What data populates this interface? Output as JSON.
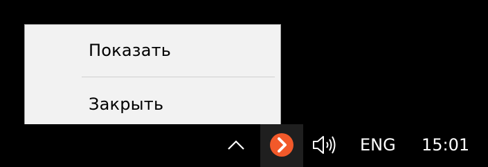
{
  "context_menu": {
    "items": [
      {
        "label": "Показать"
      },
      {
        "label": "Закрыть"
      }
    ]
  },
  "taskbar": {
    "tray": {
      "overflow_icon": "chevron-up-icon",
      "app_icon": "orange-arrow-app-icon",
      "volume_icon": "speaker-icon",
      "language": "ENG",
      "clock": "15:01"
    }
  },
  "colors": {
    "menu_background": "#f2f2f2",
    "menu_border": "#a0a0a0",
    "taskbar_background": "#000000",
    "tray_hover": "#1f1f1f",
    "app_icon_accent": "#f2592a"
  }
}
